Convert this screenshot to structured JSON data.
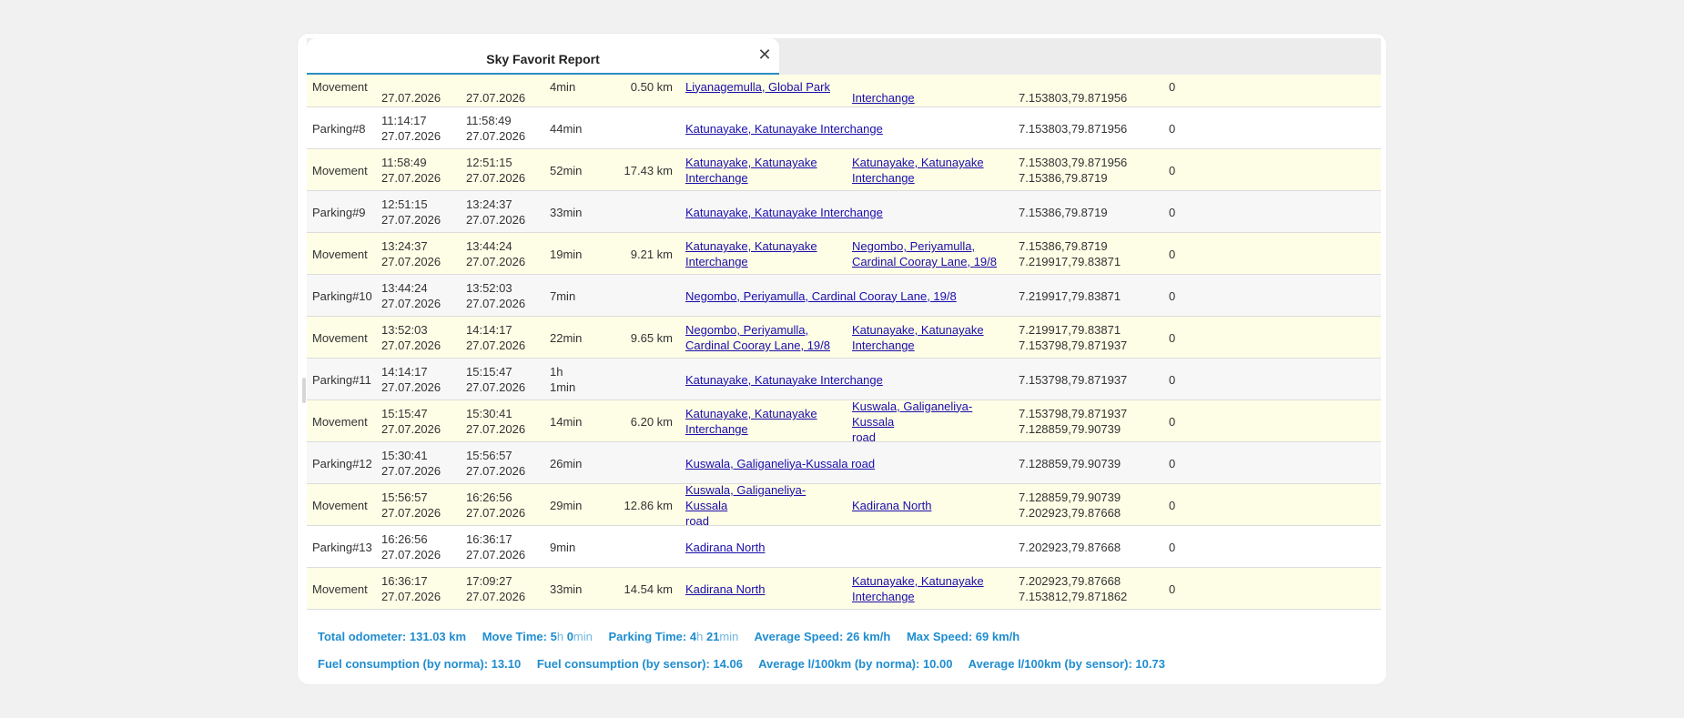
{
  "tab": {
    "title": "Sky Favorit Report",
    "close_symbol": "✕"
  },
  "partial_row": {
    "type": "Movement",
    "start_date": "27.07.2026",
    "end_date": "27.07.2026",
    "duration": "4min",
    "distance": "0.50 km",
    "from": "Liyanagemulla, Global Park",
    "to": "Interchange",
    "coord": "7.153803,79.871956",
    "fuel": "0"
  },
  "rows": [
    {
      "kind": "parking",
      "type": "Parking#8",
      "start_time": "11:14:17",
      "start_date": "27.07.2026",
      "end_time": "11:58:49",
      "end_date": "27.07.2026",
      "duration": "44min",
      "location": "Katunayake, Katunayake Interchange",
      "coord": "7.153803,79.871956",
      "fuel": "0"
    },
    {
      "kind": "movement",
      "type": "Movement",
      "start_time": "11:58:49",
      "start_date": "27.07.2026",
      "end_time": "12:51:15",
      "end_date": "27.07.2026",
      "duration": "52min",
      "distance": "17.43 km",
      "from_1": "Katunayake, Katunayake",
      "from_2": "Interchange",
      "to_1": "Katunayake, Katunayake",
      "to_2": "Interchange",
      "coord_1": "7.153803,79.871956",
      "coord_2": "7.15386,79.8719",
      "fuel": "0"
    },
    {
      "kind": "parking",
      "type": "Parking#9",
      "start_time": "12:51:15",
      "start_date": "27.07.2026",
      "end_time": "13:24:37",
      "end_date": "27.07.2026",
      "duration": "33min",
      "location": "Katunayake, Katunayake Interchange",
      "coord": "7.15386,79.8719",
      "fuel": "0"
    },
    {
      "kind": "movement",
      "type": "Movement",
      "start_time": "13:24:37",
      "start_date": "27.07.2026",
      "end_time": "13:44:24",
      "end_date": "27.07.2026",
      "duration": "19min",
      "distance": "9.21 km",
      "from_1": "Katunayake, Katunayake",
      "from_2": "Interchange",
      "to_1": "Negombo, Periyamulla,",
      "to_2": "Cardinal Cooray Lane, 19/8",
      "coord_1": "7.15386,79.8719",
      "coord_2": "7.219917,79.83871",
      "fuel": "0"
    },
    {
      "kind": "parking",
      "type": "Parking#10",
      "start_time": "13:44:24",
      "start_date": "27.07.2026",
      "end_time": "13:52:03",
      "end_date": "27.07.2026",
      "duration": "7min",
      "location": "Negombo, Periyamulla, Cardinal Cooray Lane, 19/8",
      "coord": "7.219917,79.83871",
      "fuel": "0"
    },
    {
      "kind": "movement",
      "type": "Movement",
      "start_time": "13:52:03",
      "start_date": "27.07.2026",
      "end_time": "14:14:17",
      "end_date": "27.07.2026",
      "duration": "22min",
      "distance": "9.65 km",
      "from_1": "Negombo, Periyamulla,",
      "from_2": "Cardinal Cooray Lane, 19/8",
      "to_1": "Katunayake, Katunayake",
      "to_2": "Interchange",
      "coord_1": "7.219917,79.83871",
      "coord_2": "7.153798,79.871937",
      "fuel": "0"
    },
    {
      "kind": "parking",
      "type": "Parking#11",
      "start_time": "14:14:17",
      "start_date": "27.07.2026",
      "end_time": "15:15:47",
      "end_date": "27.07.2026",
      "duration_1": "1h",
      "duration_2": "1min",
      "location": "Katunayake, Katunayake Interchange",
      "coord": "7.153798,79.871937",
      "fuel": "0"
    },
    {
      "kind": "movement",
      "type": "Movement",
      "start_time": "15:15:47",
      "start_date": "27.07.2026",
      "end_time": "15:30:41",
      "end_date": "27.07.2026",
      "duration": "14min",
      "distance": "6.20 km",
      "from_1": "Katunayake, Katunayake",
      "from_2": "Interchange",
      "to_1": "Kuswala, Galiganeliya-Kussala",
      "to_2": "road",
      "coord_1": "7.153798,79.871937",
      "coord_2": "7.128859,79.90739",
      "fuel": "0"
    },
    {
      "kind": "parking",
      "type": "Parking#12",
      "start_time": "15:30:41",
      "start_date": "27.07.2026",
      "end_time": "15:56:57",
      "end_date": "27.07.2026",
      "duration": "26min",
      "location": "Kuswala, Galiganeliya-Kussala road",
      "coord": "7.128859,79.90739",
      "fuel": "0"
    },
    {
      "kind": "movement",
      "type": "Movement",
      "start_time": "15:56:57",
      "start_date": "27.07.2026",
      "end_time": "16:26:56",
      "end_date": "27.07.2026",
      "duration": "29min",
      "distance": "12.86 km",
      "from_1": "Kuswala, Galiganeliya-Kussala",
      "from_2": "road",
      "to_1": "Kadirana North",
      "to_2": "",
      "coord_1": "7.128859,79.90739",
      "coord_2": "7.202923,79.87668",
      "fuel": "0"
    },
    {
      "kind": "parking",
      "type": "Parking#13",
      "start_time": "16:26:56",
      "start_date": "27.07.2026",
      "end_time": "16:36:17",
      "end_date": "27.07.2026",
      "duration": "9min",
      "location": "Kadirana North",
      "coord": "7.202923,79.87668",
      "fuel": "0"
    },
    {
      "kind": "movement",
      "type": "Movement",
      "start_time": "16:36:17",
      "start_date": "27.07.2026",
      "end_time": "17:09:27",
      "end_date": "27.07.2026",
      "duration": "33min",
      "distance": "14.54 km",
      "from_1": "Kadirana North",
      "from_2": "",
      "to_1": "Katunayake, Katunayake",
      "to_2": "Interchange",
      "coord_1": "7.202923,79.87668",
      "coord_2": "7.153812,79.871862",
      "fuel": "0"
    }
  ],
  "summary": {
    "line1": {
      "odometer_label": "Total odometer:",
      "odometer_value": "131.03 km",
      "move_label": "Move Time:",
      "move_h": "5",
      "move_h_unit": "h",
      "move_m": "0",
      "move_m_unit": "min",
      "parking_label": "Parking Time:",
      "parking_h": "4",
      "parking_h_unit": "h",
      "parking_m": "21",
      "parking_m_unit": "min",
      "avg_speed": "Average Speed: 26 km/h",
      "max_speed": "Max Speed: 69 km/h"
    },
    "line2": {
      "fuel_norma": "Fuel consumption (by norma): 13.10",
      "fuel_sensor": "Fuel consumption (by sensor): 14.06",
      "avg_norma": "Average l/100km (by norma): 10.00",
      "avg_sensor": "Average l/100km (by sensor): 10.73"
    }
  }
}
